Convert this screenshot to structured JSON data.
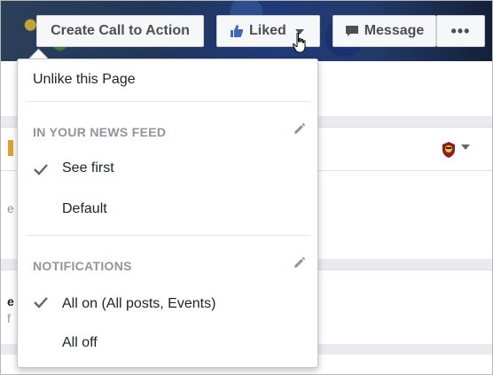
{
  "header": {
    "create_cta_label": "Create Call to Action",
    "liked_label": "Liked",
    "message_label": "Message",
    "more_label": "•••"
  },
  "menu": {
    "unlike_label": "Unlike this Page",
    "news_feed": {
      "section_label": "IN YOUR NEWS FEED",
      "options": [
        {
          "label": "See first",
          "checked": true
        },
        {
          "label": "Default",
          "checked": false
        }
      ]
    },
    "notifications": {
      "section_label": "NOTIFICATIONS",
      "options": [
        {
          "label": "All on (All posts, Events)",
          "checked": true
        },
        {
          "label": "All off",
          "checked": false
        }
      ]
    }
  },
  "background": {
    "peek_1": "e",
    "peek_2": "e",
    "peek_3": "f"
  },
  "colors": {
    "like_blue": "#4267b2",
    "button_bg": "#f6f7f9",
    "section_gray": "#90949c",
    "text_dark": "#1d2129"
  },
  "icons": {
    "liked": "thumbs-up-icon",
    "message": "speech-bubble-icon",
    "edit": "pencil-icon",
    "check": "checkmark-icon",
    "cursor": "hand-pointer-icon",
    "post_actor": "page-profile-icon"
  }
}
